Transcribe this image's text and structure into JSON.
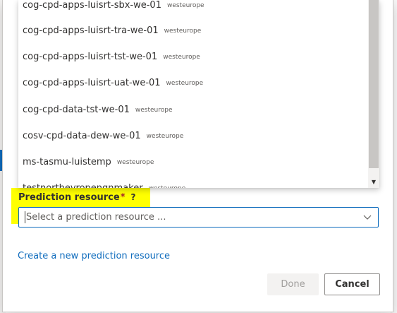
{
  "dropdown": {
    "options": [
      {
        "name": "cog-cpd-apps-luisrt-sbx-we-01",
        "region": "westeurope"
      },
      {
        "name": "cog-cpd-apps-luisrt-tra-we-01",
        "region": "westeurope"
      },
      {
        "name": "cog-cpd-apps-luisrt-tst-we-01",
        "region": "westeurope"
      },
      {
        "name": "cog-cpd-apps-luisrt-uat-we-01",
        "region": "westeurope"
      },
      {
        "name": "cog-cpd-data-tst-we-01",
        "region": "westeurope"
      },
      {
        "name": "cosv-cpd-data-dew-we-01",
        "region": "westeurope"
      },
      {
        "name": "ms-tasmu-luistemp",
        "region": "westeurope"
      },
      {
        "name": "testnorthevropengnmaker",
        "region": "westeurope"
      }
    ]
  },
  "form": {
    "label": "Prediction resource",
    "required_marker": "*",
    "help_icon": "?",
    "placeholder": "Select a prediction resource ..."
  },
  "links": {
    "create_new": "Create a new prediction resource"
  },
  "buttons": {
    "done": "Done",
    "cancel": "Cancel"
  },
  "colors": {
    "accent": "#0f6cbd",
    "highlight": "#ffff00",
    "required": "#a4262c"
  }
}
